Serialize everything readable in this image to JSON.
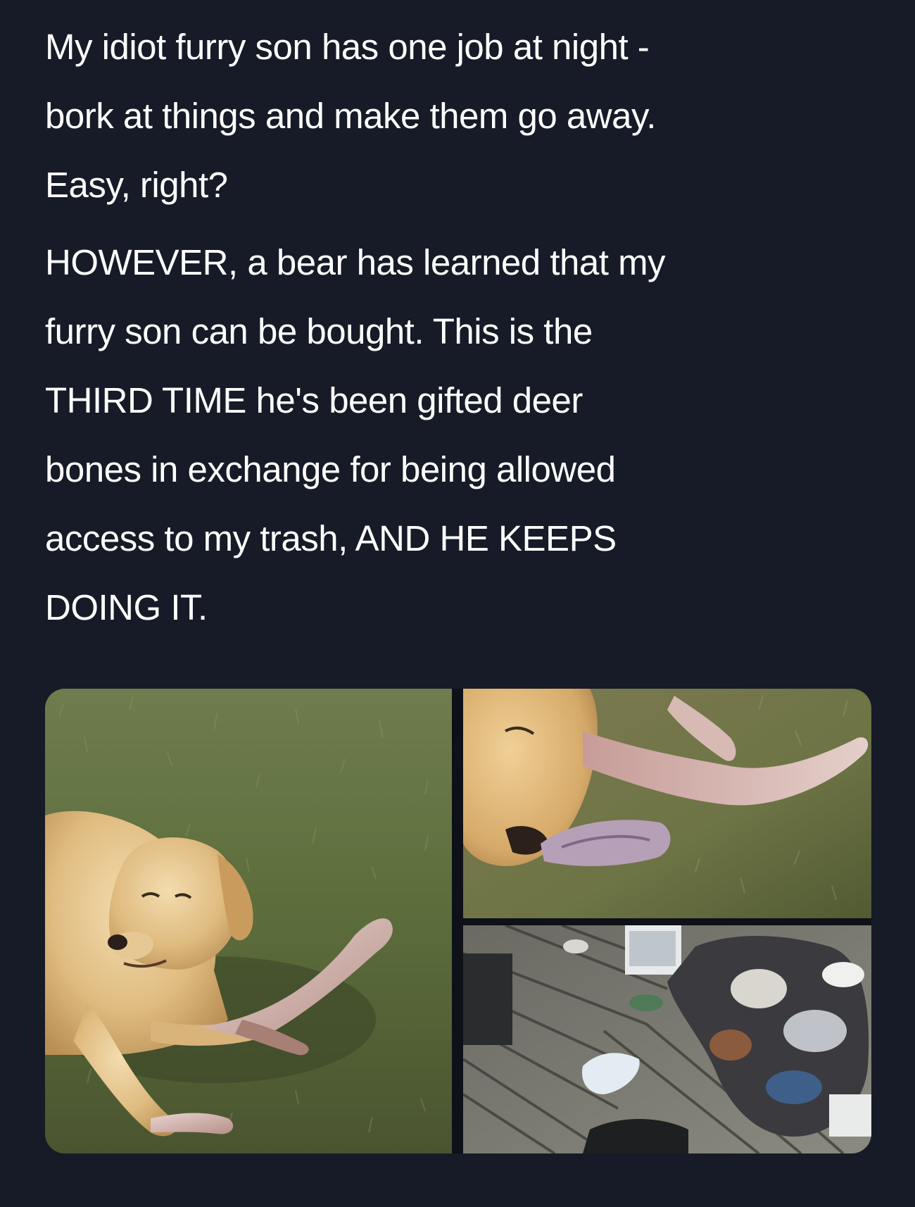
{
  "post": {
    "paragraph_1": [
      "My idiot furry son has one job at night -",
      "bork at things and make them go away.",
      "Easy, right?"
    ],
    "paragraph_2": [
      "HOWEVER, a bear has learned that my",
      "furry son can be bought. This is the",
      "THIRD TIME he's been gifted deer",
      "bones in exchange for being allowed",
      "access to my trash, AND HE KEEPS",
      "DOING IT."
    ]
  },
  "media": {
    "photos": [
      {
        "subject": "dog-lying-in-grass-with-deer-bone"
      },
      {
        "subject": "dog-chewing-deer-bone-closeup"
      },
      {
        "subject": "trash-scattered-on-wooden-deck"
      }
    ]
  },
  "colors": {
    "background": "#161b27",
    "text": "#ffffff"
  }
}
